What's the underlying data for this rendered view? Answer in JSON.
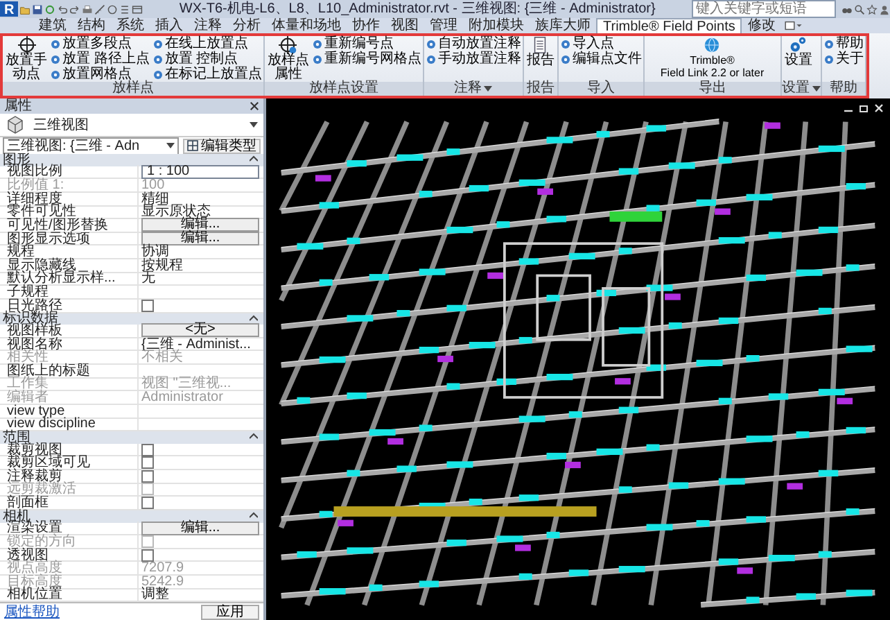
{
  "title_bar": {
    "logo": "R",
    "title": "WX-T6-机电-L6、L8、L10_Administrator.rvt - 三维视图: {三维 - Administrator}",
    "search": {
      "placeholder": "键入关键字或短语"
    }
  },
  "tabs": [
    {
      "label": "建筑",
      "selected": false
    },
    {
      "label": "结构",
      "selected": false
    },
    {
      "label": "系统",
      "selected": false
    },
    {
      "label": "插入",
      "selected": false
    },
    {
      "label": "注释",
      "selected": false
    },
    {
      "label": "分析",
      "selected": false
    },
    {
      "label": "体量和场地",
      "selected": false
    },
    {
      "label": "协作",
      "selected": false
    },
    {
      "label": "视图",
      "selected": false
    },
    {
      "label": "管理",
      "selected": false
    },
    {
      "label": "附加模块",
      "selected": false
    },
    {
      "label": "族库大师",
      "selected": false
    },
    {
      "label": "Trimble® Field Points",
      "selected": true
    },
    {
      "label": "修改",
      "selected": false
    }
  ],
  "ribbon": {
    "panels": [
      {
        "title": "放样点",
        "dropdown": false,
        "items": [
          {
            "kind": "large",
            "label": "放置手动点"
          },
          {
            "kind": "small",
            "label": "放置多段点"
          },
          {
            "kind": "small",
            "label": "放置 路径上点"
          },
          {
            "kind": "small",
            "label": "放置网格点"
          },
          {
            "kind": "small",
            "label": "在线上放置点"
          },
          {
            "kind": "small",
            "label": "放置 控制点"
          },
          {
            "kind": "small",
            "label": "在标记上放置点"
          }
        ]
      },
      {
        "title": "放样点设置",
        "dropdown": false,
        "items": [
          {
            "kind": "large",
            "label": "放样点属性"
          },
          {
            "kind": "small",
            "label": "重新编号点"
          },
          {
            "kind": "small",
            "label": "重新编号网格点"
          }
        ]
      },
      {
        "title": "注释",
        "dropdown": true,
        "items": [
          {
            "kind": "small",
            "label": "自动放置注释"
          },
          {
            "kind": "small",
            "label": "手动放置注释"
          }
        ]
      },
      {
        "title": "报告",
        "dropdown": false,
        "items": [
          {
            "kind": "large",
            "label": "报告"
          }
        ]
      },
      {
        "title": "导入",
        "dropdown": false,
        "items": [
          {
            "kind": "small",
            "label": "导入点"
          },
          {
            "kind": "small",
            "label": "编辑点文件"
          }
        ]
      },
      {
        "title": "导出",
        "dropdown": false,
        "items": [
          {
            "kind": "large",
            "label": "Trimble®\nField Link 2.2 or later"
          }
        ]
      },
      {
        "title": "设置",
        "dropdown": true,
        "items": [
          {
            "kind": "large",
            "label": "设置"
          }
        ]
      },
      {
        "title": "帮助",
        "dropdown": false,
        "items": [
          {
            "kind": "small",
            "label": "帮助"
          },
          {
            "kind": "small",
            "label": "关于"
          }
        ]
      }
    ]
  },
  "properties": {
    "title": "属性",
    "type_name": "三维视图",
    "instance": "三维视图: {三维 - Adn",
    "edit_type": "编辑类型",
    "groups": [
      {
        "name": "图形",
        "rows": [
          {
            "label": "视图比例",
            "value": "1 : 100",
            "kind": "field",
            "disabled": false
          },
          {
            "label": "比例值 1:",
            "value": "100",
            "kind": "text",
            "disabled": true
          },
          {
            "label": "详细程度",
            "value": "精细",
            "kind": "text",
            "disabled": false
          },
          {
            "label": "零件可见性",
            "value": "显示原状态",
            "kind": "text",
            "disabled": false
          },
          {
            "label": "可见性/图形替换",
            "value": "编辑...",
            "kind": "button",
            "disabled": false
          },
          {
            "label": "图形显示选项",
            "value": "编辑...",
            "kind": "button",
            "disabled": false
          },
          {
            "label": "规程",
            "value": "协调",
            "kind": "text",
            "disabled": false
          },
          {
            "label": "显示隐藏线",
            "value": "按规程",
            "kind": "text",
            "disabled": false
          },
          {
            "label": "默认分析显示样...",
            "value": "无",
            "kind": "text",
            "disabled": false
          },
          {
            "label": "子规程",
            "kind": "text",
            "disabled": false
          },
          {
            "label": "日光路径",
            "kind": "checkbox",
            "checked": false,
            "disabled": false
          }
        ]
      },
      {
        "name": "标识数据",
        "rows": [
          {
            "label": "视图样板",
            "value": "<无>",
            "kind": "button",
            "disabled": false
          },
          {
            "label": "视图名称",
            "value": "{三维 - Administ...",
            "kind": "text",
            "disabled": false
          },
          {
            "label": "相关性",
            "value": "不相关",
            "kind": "text",
            "disabled": true
          },
          {
            "label": "图纸上的标题",
            "kind": "text",
            "disabled": false
          },
          {
            "label": "工作集",
            "value": "视图 \"三维视...",
            "kind": "text",
            "disabled": true
          },
          {
            "label": "编辑者",
            "value": "Administrator",
            "kind": "text",
            "disabled": true
          },
          {
            "label": "view type",
            "kind": "text",
            "disabled": false
          },
          {
            "label": "view discipline",
            "kind": "text",
            "disabled": false
          }
        ]
      },
      {
        "name": "范围",
        "rows": [
          {
            "label": "裁剪视图",
            "kind": "checkbox",
            "checked": false,
            "disabled": false
          },
          {
            "label": "裁剪区域可见",
            "kind": "checkbox",
            "checked": false,
            "disabled": false
          },
          {
            "label": "注释裁剪",
            "kind": "checkbox",
            "checked": false,
            "disabled": false
          },
          {
            "label": "远剪裁激活",
            "kind": "checkbox",
            "checked": false,
            "disabled": true
          },
          {
            "label": "剖面框",
            "kind": "checkbox",
            "checked": false,
            "disabled": false
          }
        ]
      },
      {
        "name": "相机",
        "rows": [
          {
            "label": "渲染设置",
            "value": "编辑...",
            "kind": "button",
            "disabled": false
          },
          {
            "label": "锁定的方向",
            "kind": "checkbox",
            "checked": false,
            "disabled": true
          },
          {
            "label": "透视图",
            "kind": "checkbox",
            "checked": false,
            "disabled": false
          },
          {
            "label": "视点高度",
            "value": "7207.9",
            "kind": "text",
            "disabled": true
          },
          {
            "label": "目标高度",
            "value": "5242.9",
            "kind": "text",
            "disabled": true
          },
          {
            "label": "相机位置",
            "value": "调整",
            "kind": "text",
            "disabled": false
          }
        ]
      }
    ],
    "help_link": "属性帮助",
    "apply": "应用"
  }
}
